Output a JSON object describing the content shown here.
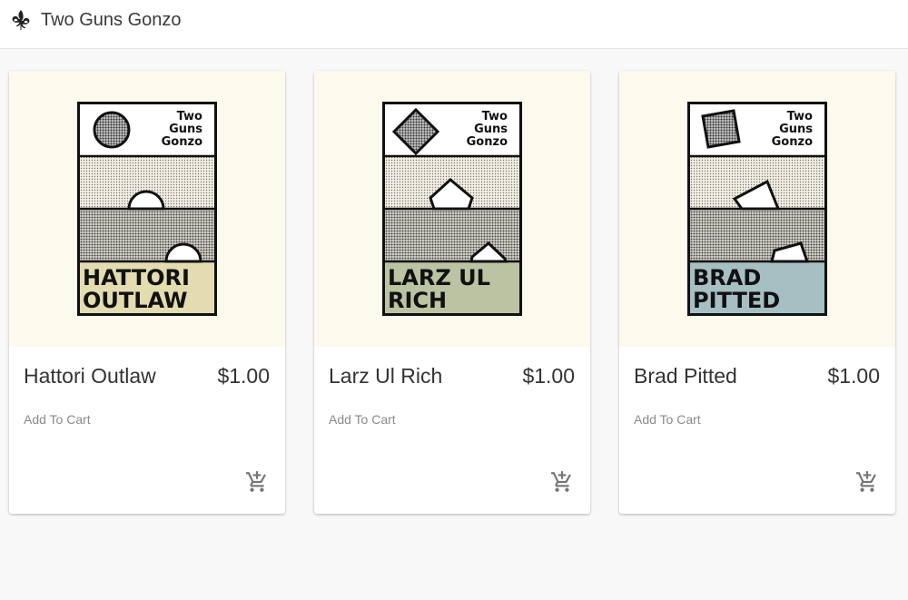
{
  "header": {
    "title": "Two Guns Gonzo",
    "logo_icon": "fleur-de-lis-icon"
  },
  "products": [
    {
      "name": "Hattori Outlaw",
      "price": "$1.00",
      "action_label": "Add To Cart",
      "cart_icon": "add-shopping-cart-icon",
      "poster": {
        "brand": [
          "Two",
          "Guns",
          "Gonzo"
        ],
        "label": [
          "HATTORI",
          "OUTLAW"
        ],
        "shape": "circle",
        "label_color": "#e3dcb0"
      }
    },
    {
      "name": "Larz Ul Rich",
      "price": "$1.00",
      "action_label": "Add To Cart",
      "cart_icon": "add-shopping-cart-icon",
      "poster": {
        "brand": [
          "Two",
          "Guns",
          "Gonzo"
        ],
        "label": [
          "LARZ UL",
          "RICH"
        ],
        "shape": "diamond",
        "label_color": "#bcc3a2"
      }
    },
    {
      "name": "Brad Pitted",
      "price": "$1.00",
      "action_label": "Add To Cart",
      "cart_icon": "add-shopping-cart-icon",
      "poster": {
        "brand": [
          "Two",
          "Guns",
          "Gonzo"
        ],
        "label": [
          "BRAD",
          "PITTED"
        ],
        "shape": "tilted-square",
        "label_color": "#a6bfc3"
      }
    }
  ]
}
